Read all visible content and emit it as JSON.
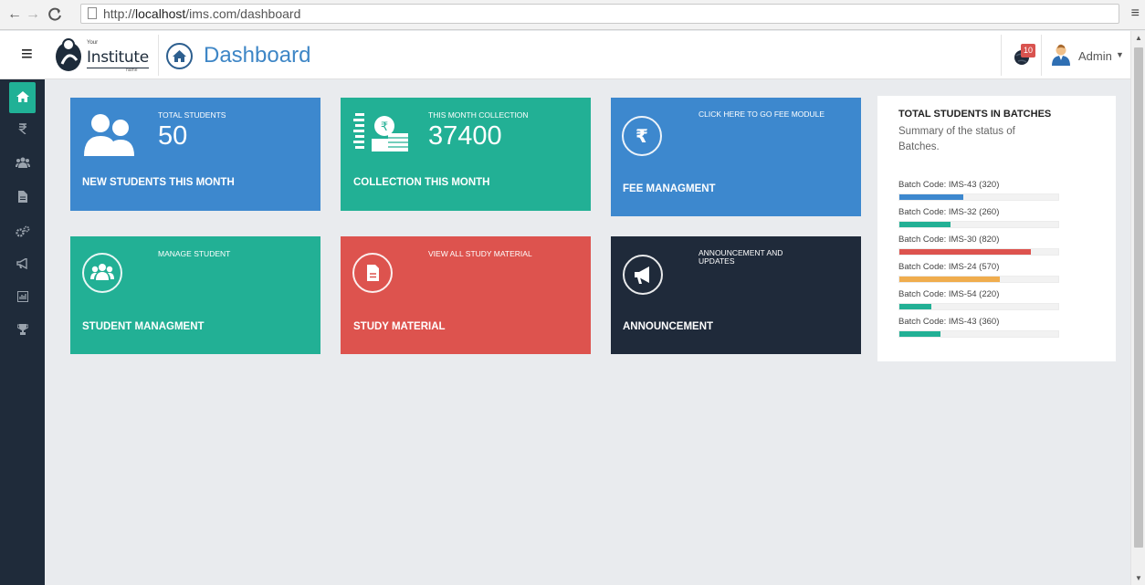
{
  "browser": {
    "url_prefix": "http://",
    "url_host": "localhost",
    "url_path": "/ims.com/dashboard"
  },
  "header": {
    "logo_small": "Your",
    "logo_main": "Institute",
    "logo_sub": "name",
    "title": "Dashboard",
    "notification_count": "10",
    "user_name": "Admin"
  },
  "sidebar": {
    "items": [
      {
        "icon": "home-icon",
        "active": true
      },
      {
        "icon": "rupee-icon",
        "active": false
      },
      {
        "icon": "users-icon",
        "active": false
      },
      {
        "icon": "file-icon",
        "active": false
      },
      {
        "icon": "cogs-icon",
        "active": false
      },
      {
        "icon": "bullhorn-icon",
        "active": false
      },
      {
        "icon": "chart-icon",
        "active": false
      },
      {
        "icon": "trophy-icon",
        "active": false
      }
    ]
  },
  "cards": {
    "students": {
      "small": "TOTAL STUDENTS",
      "value": "50",
      "label": "NEW STUDENTS THIS MONTH"
    },
    "collection": {
      "small": "THIS MONTH COLLECTION",
      "value": "37400",
      "label": "COLLECTION THIS MONTH"
    },
    "fee": {
      "small": "CLICK HERE TO GO FEE MODULE",
      "label": "FEE MANAGMENT"
    },
    "student_mgmt": {
      "small": "MANAGE STUDENT",
      "label": "STUDENT MANAGMENT"
    },
    "study": {
      "small": "VIEW ALL STUDY MATERIAL",
      "label": "STUDY MATERIAL"
    },
    "announcement": {
      "small": "ANNOUNCEMENT AND UPDATES",
      "label": "ANNOUNCEMENT"
    }
  },
  "batches": {
    "title": "TOTAL STUDENTS IN BATCHES",
    "subtitle": "Summary of the status of Batches.",
    "items": [
      {
        "label": "Batch Code: IMS-43 (320)",
        "progress": 0.4,
        "color": "#3d88ce"
      },
      {
        "label": "Batch Code: IMS-32 (260)",
        "progress": 0.32,
        "color": "#22b095"
      },
      {
        "label": "Batch Code: IMS-30 (820)",
        "progress": 0.83,
        "color": "#dd534e"
      },
      {
        "label": "Batch Code: IMS-24 (570)",
        "progress": 0.63,
        "color": "#f0ad4e"
      },
      {
        "label": "Batch Code: IMS-54 (220)",
        "progress": 0.2,
        "color": "#22b095"
      },
      {
        "label": "Batch Code: IMS-43 (360)",
        "progress": 0.26,
        "color": "#22b095"
      }
    ]
  }
}
